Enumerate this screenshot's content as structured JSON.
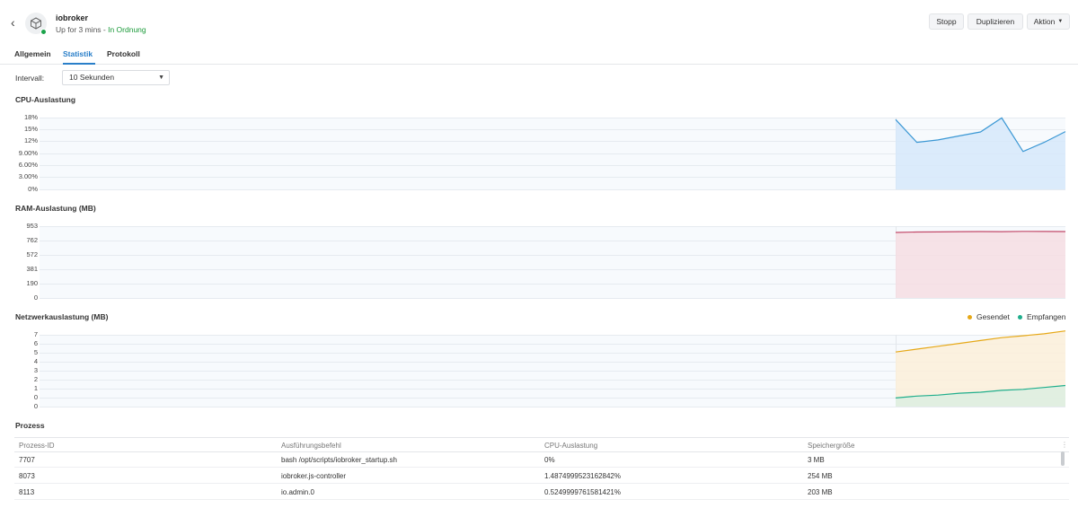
{
  "header": {
    "back_glyph": "‹",
    "title": "iobroker",
    "uptime": "Up for 3 mins - ",
    "status": "In Ordnung",
    "buttons": {
      "stop": "Stopp",
      "duplicate": "Duplizieren",
      "action": "Aktion"
    },
    "icons": {
      "back": "chevron-left-icon",
      "app": "cube-icon",
      "caret": "caret-down-icon"
    }
  },
  "tabs": [
    {
      "label": "Allgemein",
      "active": false
    },
    {
      "label": "Statistik",
      "active": true
    },
    {
      "label": "Protokoll",
      "active": false
    }
  ],
  "interval": {
    "label": "Intervall:",
    "value": "10 Sekunden"
  },
  "sections": {
    "cpu": "CPU-Auslastung",
    "ram": "RAM-Auslastung (MB)",
    "net": "Netzwerkauslastung (MB)",
    "process": "Prozess"
  },
  "legend": {
    "sent": "Gesendet",
    "received": "Empfangen"
  },
  "colors": {
    "cpu_line": "#3a97d4",
    "cpu_fill": "#d6e8fa",
    "ram_line": "#c24a6a",
    "ram_fill": "#f6dde3",
    "sent_line": "#e6a817",
    "sent_fill": "#fbefd9",
    "recv_line": "#1fae8c",
    "recv_fill": "#dceee2",
    "accent": "#2a7fc9",
    "ok": "#1b9a3a"
  },
  "chart_data": [
    {
      "type": "area",
      "title": "CPU-Auslastung",
      "ytick_labels": [
        "18%",
        "15%",
        "12%",
        "9.00%",
        "6.00%",
        "3.00%",
        "0%"
      ],
      "ylim": [
        0,
        18
      ],
      "series": [
        {
          "values": [
            17.5,
            11.8,
            12.4,
            13.4,
            14.4,
            17.9,
            9.5,
            11.8,
            14.5
          ]
        }
      ]
    },
    {
      "type": "area",
      "title": "RAM-Auslastung (MB)",
      "ytick_labels": [
        "953",
        "762",
        "572",
        "381",
        "190",
        "0"
      ],
      "ylim": [
        0,
        953
      ],
      "series": [
        {
          "values": [
            870,
            875,
            877,
            880,
            882,
            880,
            884,
            883,
            882
          ]
        }
      ]
    },
    {
      "type": "area",
      "title": "Netzwerkauslastung (MB)",
      "ytick_labels": [
        "7",
        "6",
        "5",
        "4",
        "3",
        "2",
        "1",
        "0",
        "0"
      ],
      "ylim": [
        0,
        7.5
      ],
      "legend_position": "top-right",
      "series": [
        {
          "name": "Gesendet",
          "values": [
            5.7,
            6.0,
            6.3,
            6.6,
            6.9,
            7.2,
            7.4,
            7.6,
            7.9
          ]
        },
        {
          "name": "Empfangen",
          "values": [
            0.9,
            1.1,
            1.2,
            1.4,
            1.5,
            1.7,
            1.8,
            2.0,
            2.2
          ]
        }
      ]
    }
  ],
  "process_table": {
    "headers": [
      "Prozess-ID",
      "Ausführungsbefehl",
      "CPU-Auslastung",
      "Speichergröße"
    ],
    "rows": [
      [
        "7707",
        "bash /opt/scripts/iobroker_startup.sh",
        "0%",
        "3 MB"
      ],
      [
        "8073",
        "iobroker.js-controller",
        "1.4874999523162842%",
        "254 MB"
      ],
      [
        "8113",
        "io.admin.0",
        "0.5249999761581421%",
        "203 MB"
      ]
    ]
  }
}
